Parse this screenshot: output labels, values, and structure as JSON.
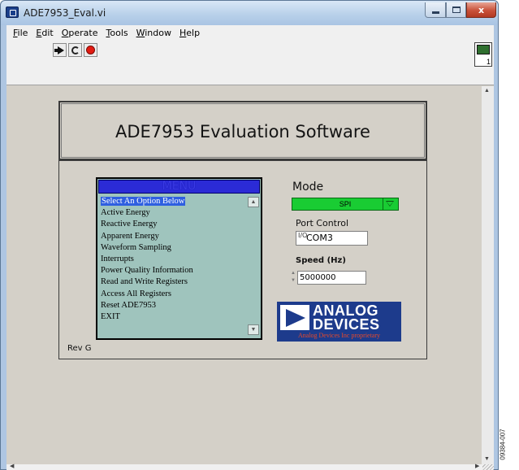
{
  "window": {
    "title": "ADE7953_Eval.vi",
    "close_glyph": "x",
    "icons": {
      "app": "labview-vi-icon",
      "minimize": "minimize-icon",
      "maximize": "maximize-icon",
      "close": "close-icon"
    }
  },
  "menubar": {
    "items": [
      "File",
      "Edit",
      "Operate",
      "Tools",
      "Window",
      "Help"
    ]
  },
  "toolbar": {
    "icons": [
      "run-arrow-icon",
      "run-continuously-icon",
      "abort-stop-icon"
    ],
    "vi_icon_number": "1"
  },
  "panel": {
    "title": "ADE7953 Evaluation Software",
    "menu": {
      "header": "MENU",
      "items": [
        "Select An Option Below",
        "Active Energy",
        "Reactive Energy",
        "Apparent Energy",
        "Waveform Sampling",
        "Interrupts",
        "Power Quality Information",
        "Read and Write Registers",
        "Access All Registers",
        "Reset ADE7953",
        "EXIT"
      ],
      "selected_index": 0
    },
    "mode": {
      "label": "Mode",
      "value": "SPI"
    },
    "port": {
      "label": "Port Control",
      "io_glyph": "I/O",
      "value": "COM3"
    },
    "speed": {
      "label": "Speed (Hz)",
      "value": "5000000"
    },
    "logo": {
      "line1": "ANALOG",
      "line2": "DEVICES",
      "tagline": "Analog Devices Inc proprietary"
    },
    "revision": "Rev G"
  },
  "figure_id": "09384-007",
  "colors": {
    "panel_bg": "#d4d0c8",
    "menu_bg": "#9fc4bd",
    "menu_header": "#2b2bd6",
    "selection": "#2f5fe0",
    "mode_ring": "#19cc33",
    "logo_bg": "#1d3b8c",
    "logo_tagline": "#e84a2a"
  }
}
